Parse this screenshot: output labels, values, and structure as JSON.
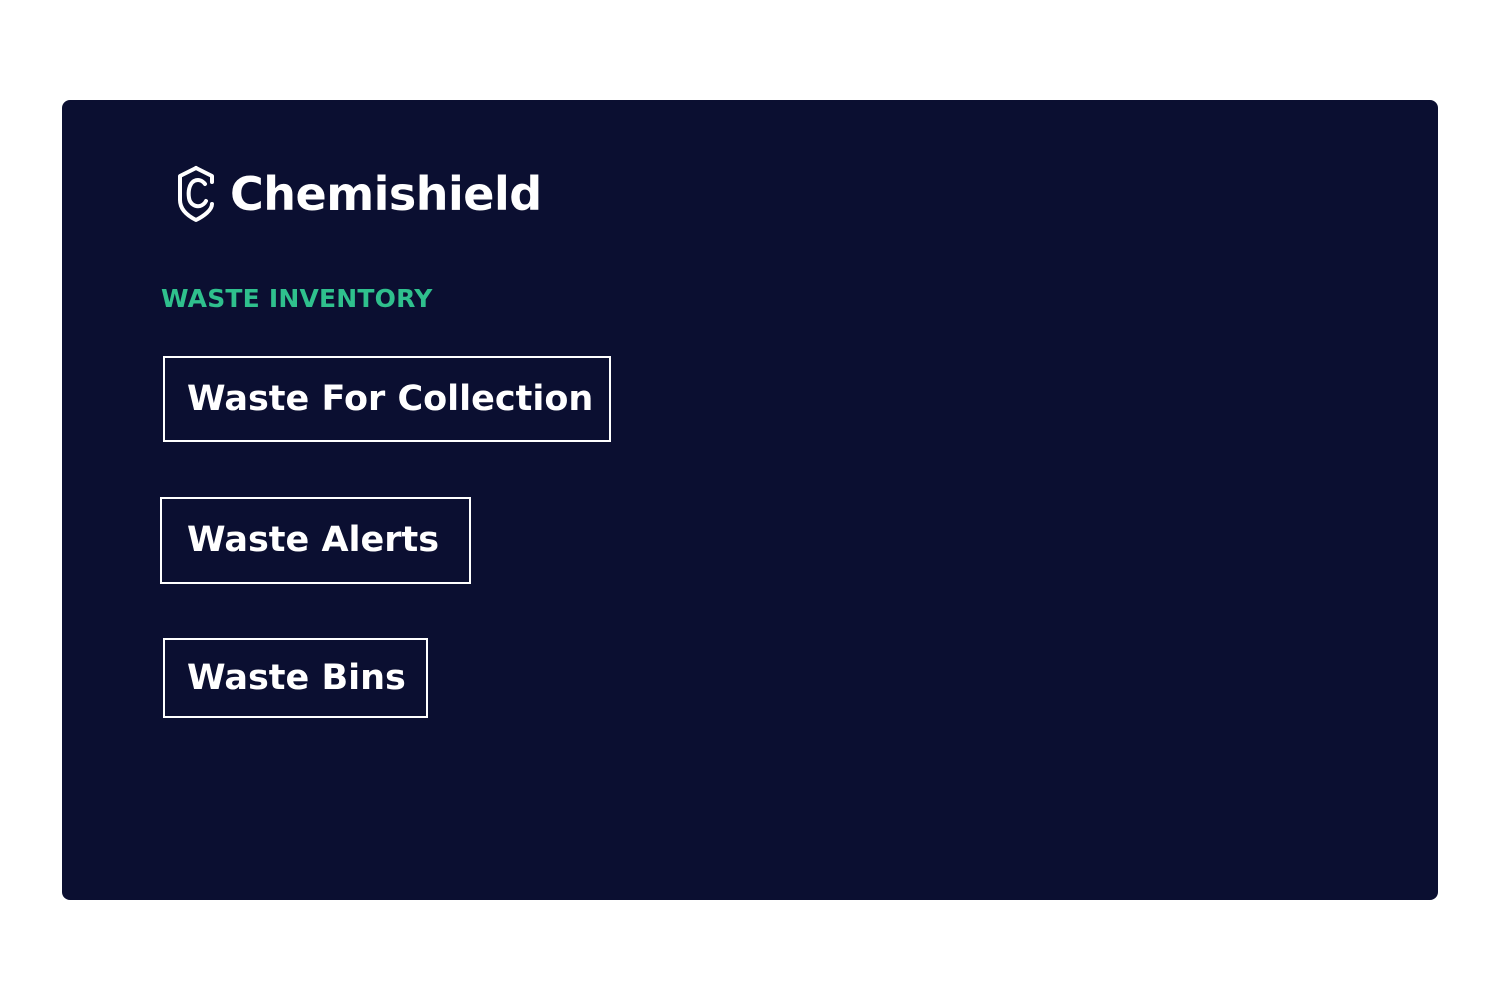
{
  "brand": {
    "name": "Chemishield",
    "icon": "shield-c-logo-icon"
  },
  "waste_inventory": {
    "section_label": "WASTE INVENTORY",
    "buttons": [
      {
        "label": "Waste For Collection"
      },
      {
        "label": "Waste Alerts"
      },
      {
        "label": "Waste Bins"
      }
    ]
  },
  "colors": {
    "panel_background": "#0b0f31",
    "page_background": "#ffffff",
    "accent": "#2fc08d",
    "text": "#ffffff"
  }
}
